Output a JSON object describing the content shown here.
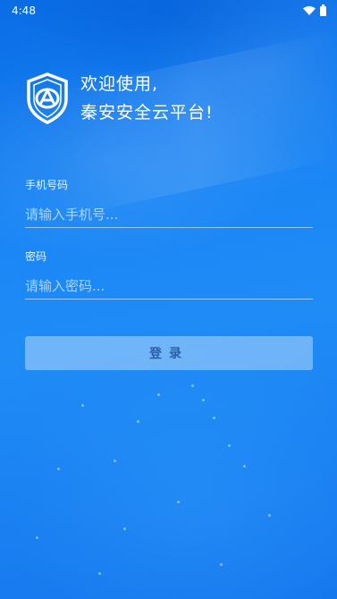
{
  "status_bar": {
    "time": "4:48"
  },
  "header": {
    "line1": "欢迎使用,",
    "line2": "秦安安全云平台!",
    "logo_icon": "shield-logo-icon"
  },
  "phone": {
    "label": "手机号码",
    "placeholder": "请输入手机号..."
  },
  "password": {
    "label": "密码",
    "placeholder": "请输入密码..."
  },
  "login": {
    "label": "登录"
  },
  "colors": {
    "bg_top": "#0a6de6",
    "bg_mid": "#1f8cf6",
    "button_text": "#2a5fa8"
  }
}
